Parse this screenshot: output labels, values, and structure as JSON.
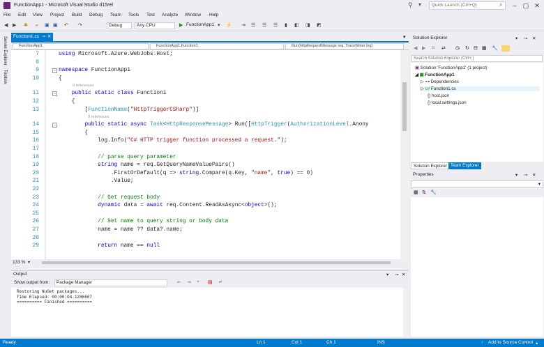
{
  "window": {
    "title": "FunctionApp1 - Microsoft Visual Studio d15rel",
    "quick_launch": "Quick Launch (Ctrl+Q)"
  },
  "menu": [
    "File",
    "Edit",
    "View",
    "Project",
    "Build",
    "Debug",
    "Team",
    "Tools",
    "Test",
    "Analyze",
    "Window",
    "Help"
  ],
  "toolbar": {
    "config": "Debug",
    "platform": "Any CPU",
    "run": "FunctionApp1"
  },
  "side_strip": {
    "server_explorer": "Server Explorer",
    "toolbox": "Toolbox"
  },
  "editor": {
    "tab": "Function1.cs",
    "nav": {
      "project": "FunctionApp1",
      "class": "FunctionApp1.Function1",
      "member": "Run(HttpRequestMessage req, TraceWriter log)"
    },
    "zoom": "133 %",
    "refs": {
      "class": "0 references",
      "method": "0 references"
    },
    "lines": [
      {
        "n": "7",
        "code": "using Microsoft.Azure.WebJobs.Host;"
      },
      {
        "n": "8",
        "code": ""
      },
      {
        "n": "9",
        "code": "namespace FunctionApp1"
      },
      {
        "n": "10",
        "code": "{"
      },
      {
        "n": "11",
        "code": "    public static class Function1"
      },
      {
        "n": "12",
        "code": "    {"
      },
      {
        "n": "13",
        "code": "        [FunctionName(\"HttpTriggerCSharp\")]"
      },
      {
        "n": "14",
        "code": "        public static async Task<HttpResponseMessage> Run([HttpTrigger(AuthorizationLevel.Anony"
      },
      {
        "n": "15",
        "code": "        {"
      },
      {
        "n": "16",
        "code": "            log.Info(\"C# HTTP trigger function processed a request.\");"
      },
      {
        "n": "17",
        "code": ""
      },
      {
        "n": "18",
        "code": "            // parse query parameter"
      },
      {
        "n": "19",
        "code": "            string name = req.GetQueryNameValuePairs()"
      },
      {
        "n": "20",
        "code": "                .FirstOrDefault(q => string.Compare(q.Key, \"name\", true) == 0)"
      },
      {
        "n": "21",
        "code": "                .Value;"
      },
      {
        "n": "22",
        "code": ""
      },
      {
        "n": "23",
        "code": "            // Get request body"
      },
      {
        "n": "24",
        "code": "            dynamic data = await req.Content.ReadAsAsync<object>();"
      },
      {
        "n": "25",
        "code": ""
      },
      {
        "n": "26",
        "code": "            // Set name to query string or body data"
      },
      {
        "n": "27",
        "code": "            name = name ?? data?.name;"
      },
      {
        "n": "28",
        "code": ""
      },
      {
        "n": "29",
        "code": "            return name == null"
      }
    ]
  },
  "output": {
    "title": "Output",
    "show_from_label": "Show output from:",
    "source": "Package Manager",
    "lines": [
      "Restoring NuGet packages...",
      "Time Elapsed: 00:00:04.1286607",
      "========== Finished =========="
    ]
  },
  "solution_explorer": {
    "title": "Solution Explorer",
    "search": "Search Solution Explorer (Ctrl+;)",
    "items": [
      {
        "label": "Solution 'FunctionApp1' (1 project)"
      },
      {
        "label": "FunctionApp1"
      },
      {
        "label": "Dependencies"
      },
      {
        "label": "Function1.cs"
      },
      {
        "label": "host.json"
      },
      {
        "label": "local.settings.json"
      }
    ],
    "tabs": [
      "Solution Explorer",
      "Team Explorer"
    ]
  },
  "properties": {
    "title": "Properties"
  },
  "status": {
    "ready": "Ready",
    "ln": "Ln 1",
    "col": "Col 1",
    "ch": "Ch 1",
    "ins": "INS",
    "source_control": "Add to Source Control"
  },
  "colors": {
    "accent": "#007acc",
    "keyword": "#0000ff",
    "type": "#2b91af",
    "string": "#a31515",
    "comment": "#008000"
  }
}
